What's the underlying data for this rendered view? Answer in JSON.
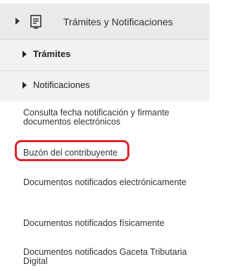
{
  "section": {
    "title": "Trámites y Notificaciones",
    "icon": "document-list-icon"
  },
  "submenus": [
    {
      "label": "Trámites",
      "icon": "caret-right-icon"
    },
    {
      "label": "Notificaciones",
      "icon": "caret-right-icon"
    }
  ],
  "links": [
    {
      "label": "Consulta fecha notificación y firmante documentos electrónicos"
    },
    {
      "label": "Buzón del contribuyente"
    },
    {
      "label": "Documentos notificados electrónicamente"
    },
    {
      "label": "Documentos notificados físicamente"
    },
    {
      "label": "Documentos notificados Gaceta Tributaria Digital"
    }
  ],
  "highlight_color": "#e0222c"
}
